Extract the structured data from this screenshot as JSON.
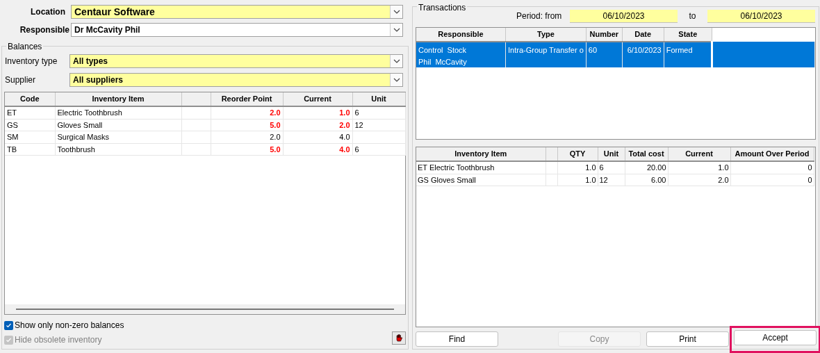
{
  "location": {
    "label": "Location",
    "value": "Centaur Software"
  },
  "responsible": {
    "label": "Responsible",
    "value": "Dr McCavity Phil"
  },
  "balances": {
    "title": "Balances",
    "filters": [
      {
        "label": "Inventory type",
        "value": "All types"
      },
      {
        "label": "Supplier",
        "value": "All suppliers"
      }
    ],
    "table": {
      "columns": [
        "Code",
        "Inventory Item",
        "",
        "Reorder Point",
        "Current",
        "Unit"
      ],
      "rows": [
        {
          "code": "ET",
          "item": "Electric Toothbrush",
          "reorder": "2.0",
          "current": "1.0",
          "unit": "6",
          "alert": true
        },
        {
          "code": "GS",
          "item": "Gloves Small",
          "reorder": "5.0",
          "current": "2.0",
          "unit": "12",
          "alert": true
        },
        {
          "code": "SM",
          "item": "Surgical Masks",
          "reorder": "2.0",
          "current": "4.0",
          "unit": "",
          "alert": false
        },
        {
          "code": "TB",
          "item": "Toothbrush",
          "reorder": "5.0",
          "current": "4.0",
          "unit": "6",
          "alert": true
        }
      ]
    },
    "options": [
      {
        "label": "Show only non-zero balances",
        "checked": true,
        "disabled": false
      },
      {
        "label": "Hide obsolete inventory",
        "checked": true,
        "disabled": true
      }
    ]
  },
  "transactions": {
    "title": "Transactions",
    "period_label": "Period: from",
    "from": "06/10/2023",
    "to_label": "to",
    "to": "06/10/2023",
    "table": {
      "columns": [
        "Responsible",
        "Type",
        "Number",
        "Date",
        "State"
      ],
      "rows": [
        {
          "responsible": [
            "Control  Stock",
            "Phil  McCavity"
          ],
          "type": "Intra-Group Transfer o",
          "number": "60",
          "date": "6/10/2023",
          "state": "Formed",
          "selected": true
        }
      ]
    },
    "items": {
      "columns": [
        "Inventory Item",
        "",
        "QTY",
        "Unit",
        "Total cost",
        "Current",
        "Amount Over Period"
      ],
      "rows": [
        {
          "item": "ET Electric Toothbrush",
          "qty": "1.0",
          "unit": "6",
          "total": "20.00",
          "current": "1.0",
          "amount": "0"
        },
        {
          "item": "GS Gloves Small",
          "qty": "1.0",
          "unit": "12",
          "total": "6.00",
          "current": "2.0",
          "amount": "0"
        }
      ]
    },
    "buttons": [
      {
        "label": "Find",
        "disabled": false,
        "highlighted": false
      },
      {
        "label": "Copy",
        "disabled": true,
        "highlighted": false
      },
      {
        "label": "Print",
        "disabled": false,
        "highlighted": false
      },
      {
        "label": "Accept",
        "disabled": false,
        "highlighted": true
      }
    ]
  }
}
